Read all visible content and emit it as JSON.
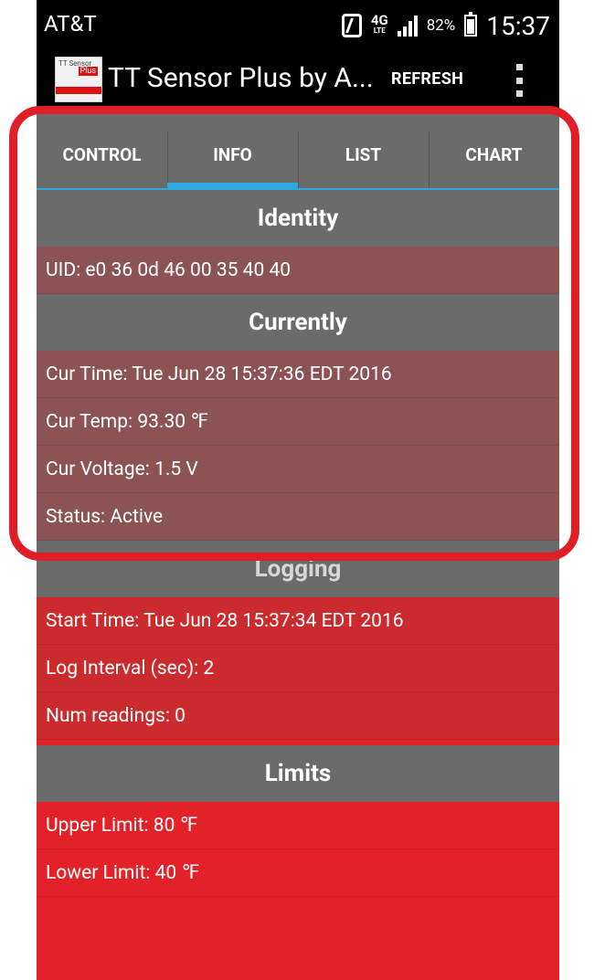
{
  "status_bar": {
    "carrier": "AT&T",
    "network": "4G",
    "network_sub": "LTE",
    "battery": "82%",
    "time": "15:37"
  },
  "app_bar": {
    "logo_text": "TT Sensor",
    "logo_plus": "Plus",
    "title": "TT Sensor Plus by A...",
    "refresh_label": "REFRESH"
  },
  "tabs": [
    {
      "label": "CONTROL",
      "active": false
    },
    {
      "label": "INFO",
      "active": true
    },
    {
      "label": "LIST",
      "active": false
    },
    {
      "label": "CHART",
      "active": false
    }
  ],
  "identity": {
    "header": "Identity",
    "uid": "UID: e0 36 0d 46 00 35 40 40"
  },
  "currently": {
    "header": "Currently",
    "cur_time": "Cur Time: Tue Jun 28 15:37:36 EDT 2016",
    "cur_temp": "Cur Temp: 93.30 ℉",
    "cur_voltage": "Cur Voltage: 1.5 V",
    "status": "Status: Active"
  },
  "logging": {
    "header": "Logging",
    "start_time": "Start Time: Tue Jun 28 15:37:34 EDT 2016",
    "log_interval": "Log Interval (sec): 2",
    "num_readings": "Num readings: 0"
  },
  "limits": {
    "header": "Limits",
    "upper": "Upper Limit: 80 ℉",
    "lower": "Lower Limit: 40 ℉"
  },
  "colors": {
    "accent_tab": "#2ca9e1",
    "app_red": "#e22228",
    "header_gray": "#6b6b6b",
    "highlight": "#e01e26"
  }
}
